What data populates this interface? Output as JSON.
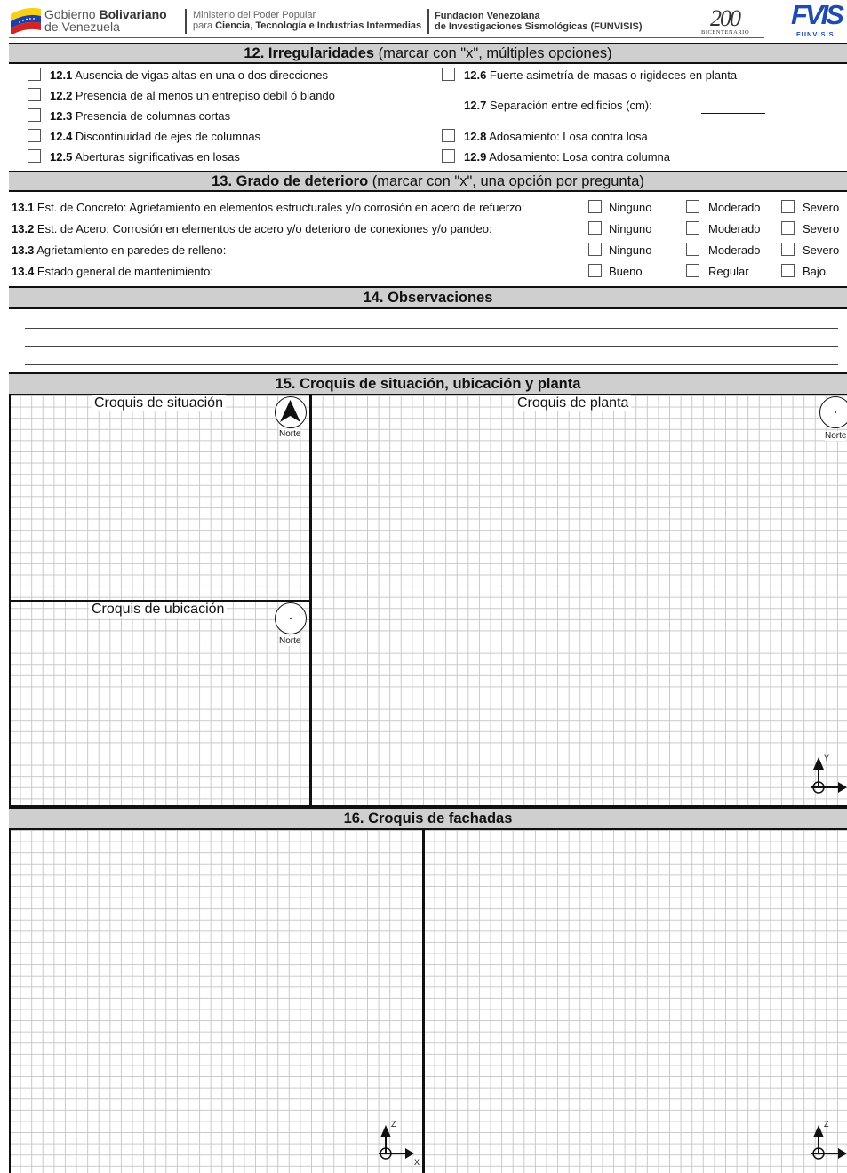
{
  "header": {
    "gov_line1_a": "Gobierno ",
    "gov_line1_b": "Bolivariano",
    "gov_line2": "de Venezuela",
    "ministry_line1": "Ministerio del Poder Popular",
    "ministry_line2_a": "para ",
    "ministry_line2_b": "Ciencia, Tecnología e Industrias Intermedias",
    "funvisis_line1": "Fundación Venezolana",
    "funvisis_line2": "de Investigaciones Sismológicas (FUNVISIS)",
    "bicentenario_number": "200",
    "bicentenario_label": "BICENTENARIO",
    "funvisis_logo_text": "FVIS",
    "funvisis_logo_sub": "FUNVISIS",
    "flag_colors": [
      "#f7d117",
      "#1f3fa6",
      "#d42323"
    ]
  },
  "section12": {
    "title_bold": "12. Irregularidades",
    "title_rest": " (marcar con \"x\",  múltiples opciones)",
    "items_left": [
      {
        "num": "12.1",
        "text": " Ausencia de vigas altas en una o dos direcciones"
      },
      {
        "num": "12.2",
        "text": " Presencia de al menos un entrepiso debil ó blando"
      },
      {
        "num": "12.3",
        "text": " Presencia de columnas cortas"
      },
      {
        "num": "12.4",
        "text": " Discontinuidad de ejes de columnas"
      },
      {
        "num": "12.5",
        "text": " Aberturas significativas en losas"
      }
    ],
    "items_right": [
      {
        "num": "12.6",
        "text": " Fuerte asimetría de masas o rigideces en planta"
      },
      {
        "num": "12.7",
        "text": " Separación entre edificios (cm):"
      },
      {
        "num": "12.8",
        "text": " Adosamiento: Losa contra losa"
      },
      {
        "num": "12.9",
        "text": " Adosamiento: Losa contra columna"
      }
    ]
  },
  "section13": {
    "title_bold": "13. Grado de deterioro",
    "title_rest": " (marcar con \"x\", una opción por pregunta)",
    "rows": [
      {
        "num": "13.1",
        "text": " Est. de Concreto:  Agrietamiento en elementos estructurales y/o corrosión en acero de refuerzo:",
        "options": [
          "Ninguno",
          "Moderado",
          "Severo"
        ]
      },
      {
        "num": "13.2",
        "text": " Est. de Acero: Corrosión en elementos de acero y/o deterioro de conexiones y/o pandeo:",
        "options": [
          "Ninguno",
          "Moderado",
          "Severo"
        ]
      },
      {
        "num": "13.3",
        "text": " Agrietamiento en paredes de relleno:",
        "options": [
          "Ninguno",
          "Moderado",
          "Severo"
        ]
      },
      {
        "num": "13.4",
        "text": " Estado general de mantenimiento:",
        "options": [
          "Bueno",
          "Regular",
          "Bajo"
        ]
      }
    ]
  },
  "section14": {
    "title": "14. Observaciones"
  },
  "section15": {
    "title": "15. Croquis de situación, ubicación y planta",
    "situacion": "Croquis de situación",
    "ubicacion": "Croquis de ubicación",
    "planta": "Croquis de planta",
    "north_label": "Norte",
    "axis_y": "Y"
  },
  "section16": {
    "title": "16. Croquis de fachadas",
    "axis_z": "Z",
    "axis_x": "X"
  }
}
